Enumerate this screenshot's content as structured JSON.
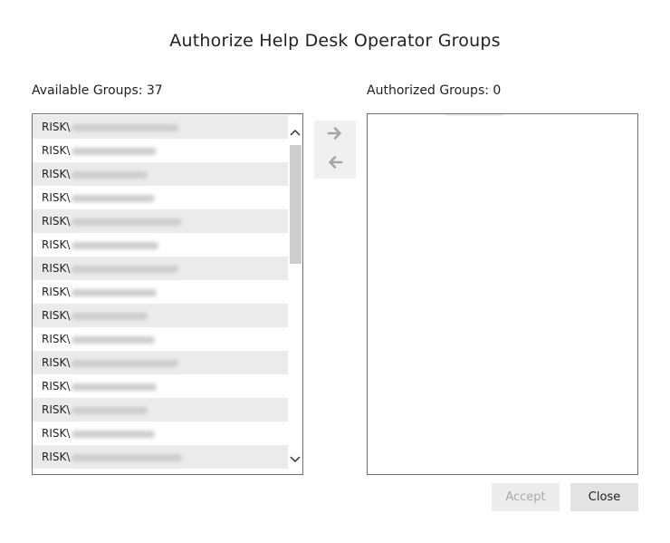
{
  "dialog": {
    "title": "Authorize Help Desk Operator Groups"
  },
  "available": {
    "label": "Available Groups: 37",
    "items": [
      {
        "prefix": "RISK\\",
        "w": 118
      },
      {
        "prefix": "RISK\\",
        "w": 94
      },
      {
        "prefix": "RISK\\",
        "w": 84
      },
      {
        "prefix": "RISK\\",
        "w": 92
      },
      {
        "prefix": "RISK\\",
        "w": 122
      },
      {
        "prefix": "RISK\\",
        "w": 96
      },
      {
        "prefix": "RISK\\",
        "w": 118
      },
      {
        "prefix": "RISK\\",
        "w": 94
      },
      {
        "prefix": "RISK\\",
        "w": 84
      },
      {
        "prefix": "RISK\\",
        "w": 92
      },
      {
        "prefix": "RISK\\",
        "w": 118
      },
      {
        "prefix": "RISK\\",
        "w": 94
      },
      {
        "prefix": "RISK\\",
        "w": 84
      },
      {
        "prefix": "RISK\\",
        "w": 92
      },
      {
        "prefix": "RISK\\",
        "w": 122
      }
    ]
  },
  "authorized": {
    "label": "Authorized Groups: 0"
  },
  "actions": {
    "accept": "Accept",
    "close": "Close"
  },
  "icons": {
    "scroll_up": "chevron-up-icon",
    "scroll_down": "chevron-down-icon",
    "move_right": "arrow-right-icon",
    "move_left": "arrow-left-icon"
  }
}
